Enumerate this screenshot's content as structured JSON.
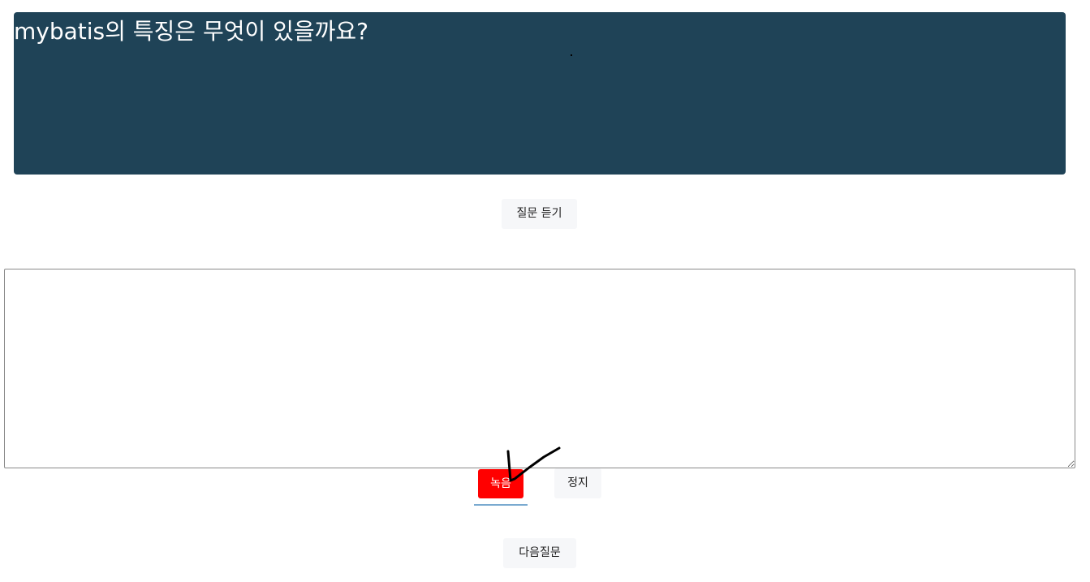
{
  "question": {
    "text": "mybatis의 특징은 무엇이 있을까요?"
  },
  "buttons": {
    "listen_label": "질문 듣기",
    "record_label": "녹음",
    "stop_label": "정지",
    "next_label": "다음질문"
  },
  "answer": {
    "value": "",
    "placeholder": ""
  },
  "colors": {
    "panel_bg": "#1f4357",
    "record_bg": "#ff0000",
    "button_bg": "#f6f7f9",
    "underline": "#7aaad0"
  }
}
